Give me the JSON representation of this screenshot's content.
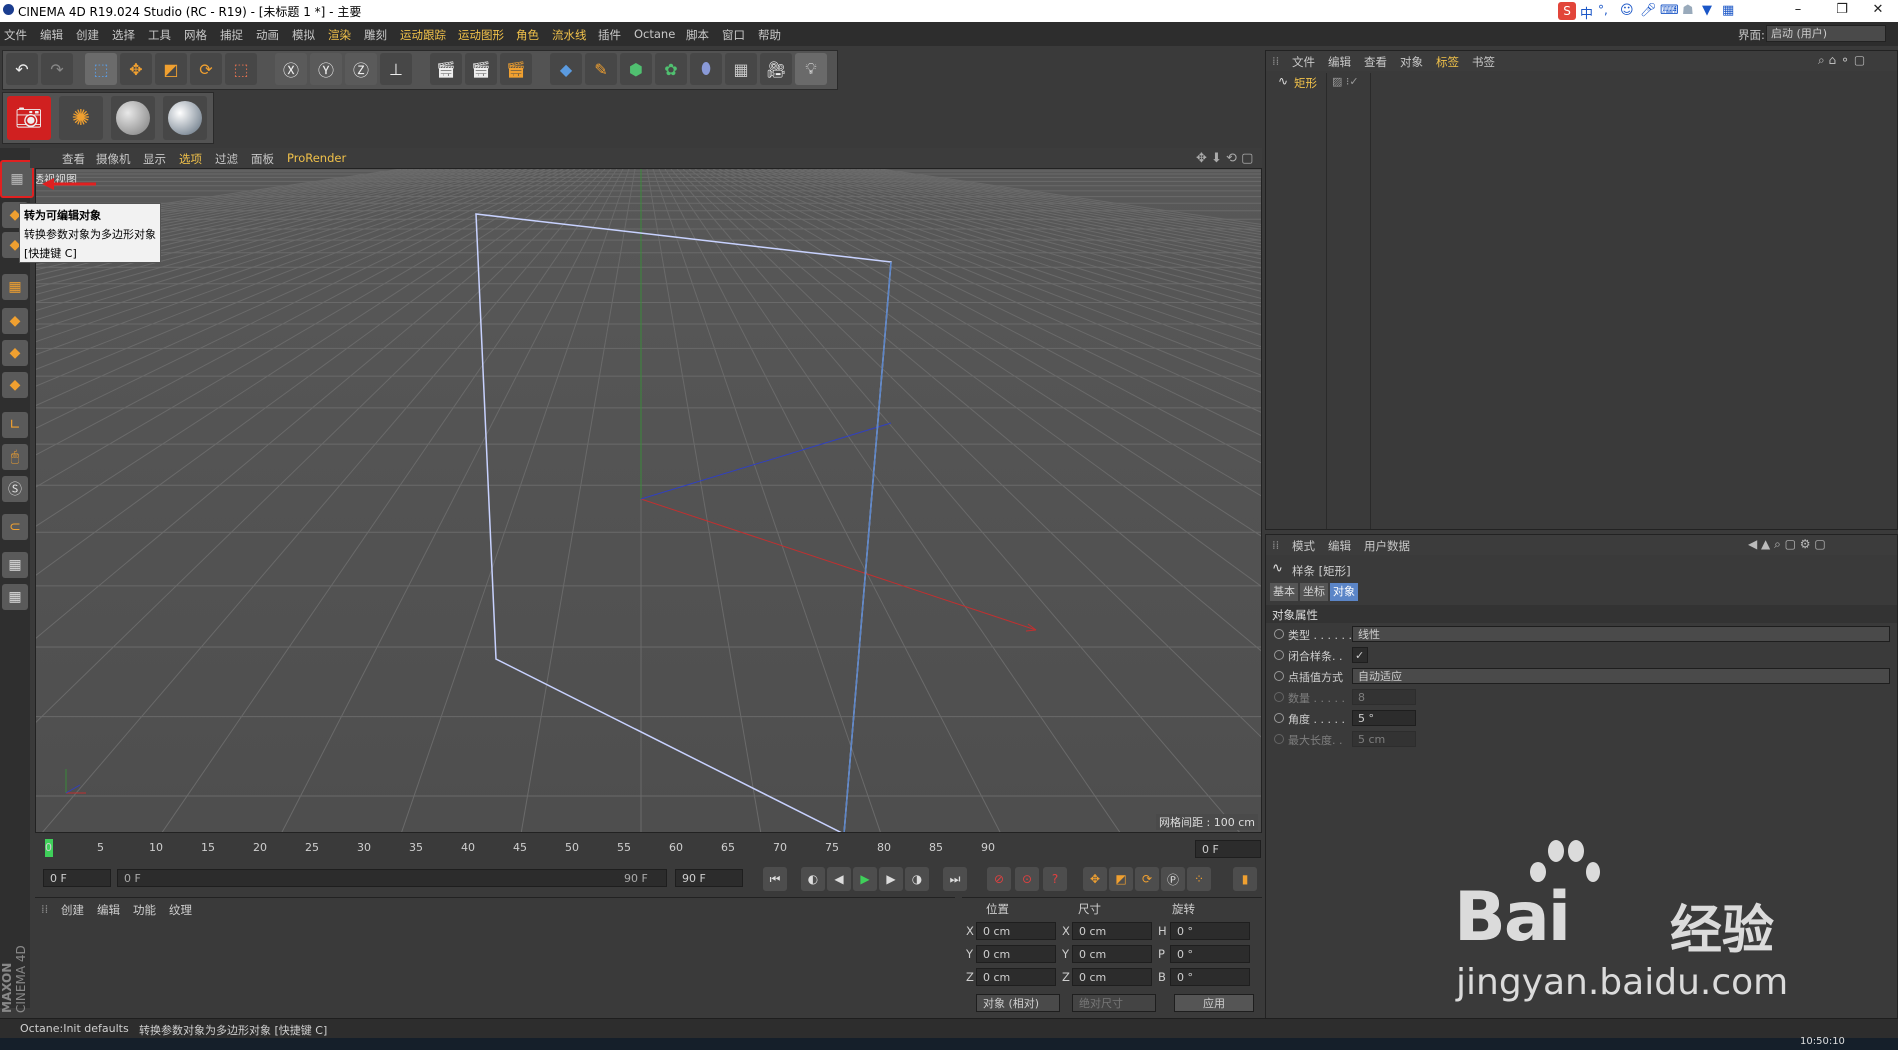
{
  "window": {
    "title": "CINEMA 4D R19.024 Studio (RC - R19) - [未标题 1 *] - 主要",
    "layout_label": "界面:",
    "layout_value": "启动 (用户)",
    "minimize": "–",
    "restore": "❐",
    "close": "✕"
  },
  "menu": [
    "文件",
    "编辑",
    "创建",
    "选择",
    "工具",
    "网格",
    "捕捉",
    "动画",
    "模拟",
    "渲染",
    "雕刻",
    "运动跟踪",
    "运动图形",
    "角色",
    "流水线",
    "插件",
    "Octane",
    "脚本",
    "窗口",
    "帮助"
  ],
  "ime": {
    "mode": "中",
    "punct": "°,"
  },
  "viewport": {
    "menu": [
      "查看",
      "摄像机",
      "显示",
      "选项",
      "过滤",
      "面板",
      "ProRender"
    ],
    "name": "透视视图",
    "grid_info": "网格间距 : 100 cm"
  },
  "tooltip": {
    "title": "转为可编辑对象",
    "description": "转换参数对象为多边形对象",
    "shortcut": "[快捷键 C]"
  },
  "timeline": {
    "ticks": [
      "0",
      "5",
      "10",
      "15",
      "20",
      "25",
      "30",
      "35",
      "40",
      "45",
      "50",
      "55",
      "60",
      "65",
      "70",
      "75",
      "80",
      "85",
      "90"
    ],
    "current_frame": "0 F",
    "start_frame": "0 F",
    "range_start": "0 F",
    "range_end": "90 F",
    "end_frame": "90 F"
  },
  "material": {
    "tabs": [
      "创建",
      "编辑",
      "功能",
      "纹理"
    ]
  },
  "coords": {
    "headers": [
      "位置",
      "尺寸",
      "旋转"
    ],
    "rows": [
      {
        "axis": "X",
        "pos": "0 cm",
        "size_axis": "X",
        "size": "0 cm",
        "rot_axis": "H",
        "rot": "0 °"
      },
      {
        "axis": "Y",
        "pos": "0 cm",
        "size_axis": "Y",
        "size": "0 cm",
        "rot_axis": "P",
        "rot": "0 °"
      },
      {
        "axis": "Z",
        "pos": "0 cm",
        "size_axis": "Z",
        "size": "0 cm",
        "rot_axis": "B",
        "rot": "0 °"
      }
    ],
    "mode": "对象 (相对)",
    "size_mode": "绝对尺寸",
    "apply": "应用"
  },
  "objects": {
    "tabs": [
      "文件",
      "编辑",
      "查看",
      "对象",
      "标签",
      "书签"
    ],
    "items": [
      {
        "name": "矩形"
      }
    ]
  },
  "attributes": {
    "tabs": [
      "模式",
      "编辑",
      "用户数据"
    ],
    "object_label": "样条 [矩形]",
    "subtabs": [
      "基本",
      "坐标",
      "对象"
    ],
    "section": "对象属性",
    "rows": [
      {
        "label": "类型 . . . . . .",
        "value": "线性",
        "kind": "dropdown"
      },
      {
        "label": "闭合样条. .",
        "value": "✓",
        "kind": "check"
      },
      {
        "label": "点插值方式",
        "value": "自动适应",
        "kind": "dropdown"
      },
      {
        "label": "数量 . . . . .",
        "value": "8",
        "kind": "number",
        "disabled": true
      },
      {
        "label": "角度 . . . . .",
        "value": "5 °",
        "kind": "number"
      },
      {
        "label": "最大长度. .",
        "value": "5 cm",
        "kind": "number",
        "disabled": true
      }
    ]
  },
  "status": {
    "left": "Octane:Init defaults",
    "message": "转换参数对象为多边形对象 [快捷键 C]",
    "clock": "10:50:10"
  },
  "brand": {
    "maxon": "MAXON",
    "cinema": "CINEMA 4D"
  },
  "watermark": {
    "logo": "Bai",
    "logo2": "经验",
    "url": "jingyan.baidu.com"
  },
  "colors": {
    "accent_yellow": "#f0c14a",
    "selection_blue": "#5b85c7",
    "highlight_red": "#e02020"
  }
}
